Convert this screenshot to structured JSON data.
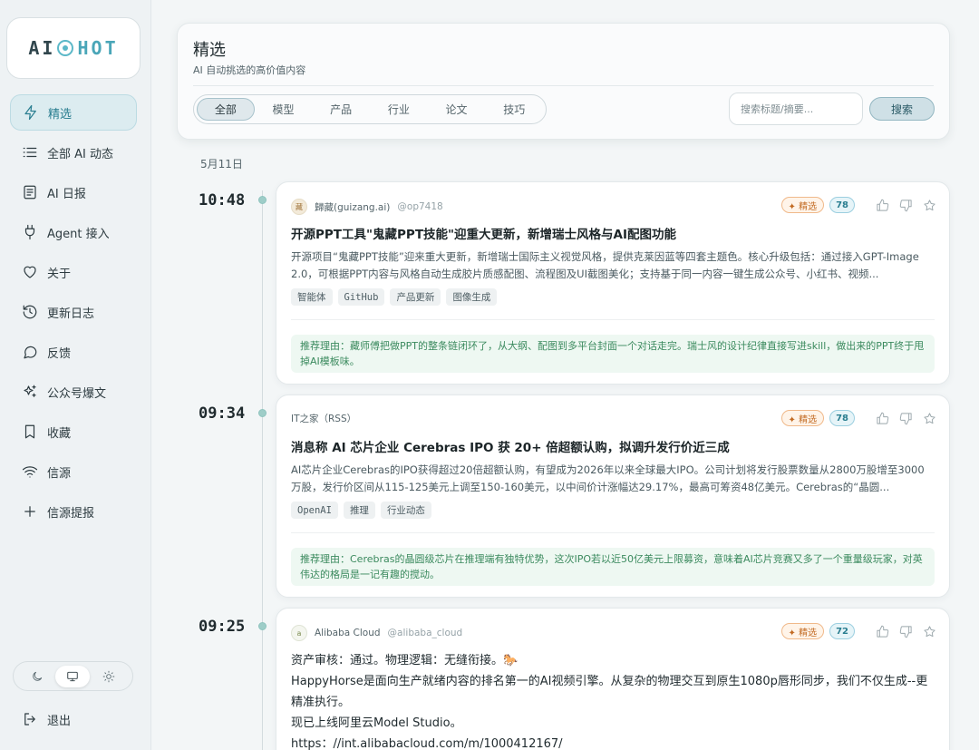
{
  "brand": {
    "logo_left": "AI",
    "logo_right": "HOT"
  },
  "sidebar": {
    "items": [
      {
        "label": "精选",
        "icon": "lightning-icon",
        "active": true
      },
      {
        "label": "全部 AI 动态",
        "icon": "list-icon"
      },
      {
        "label": "AI 日报",
        "icon": "newspaper-icon"
      },
      {
        "label": "Agent 接入",
        "icon": "plug-icon"
      },
      {
        "label": "关于",
        "icon": "heart-icon"
      },
      {
        "label": "更新日志",
        "icon": "history-icon"
      },
      {
        "label": "反馈",
        "icon": "chat-icon"
      },
      {
        "label": "公众号爆文",
        "icon": "sparkles-icon"
      },
      {
        "label": "收藏",
        "icon": "bookmark-icon"
      },
      {
        "label": "信源",
        "icon": "wifi-icon"
      },
      {
        "label": "信源提报",
        "icon": "plus-icon"
      }
    ],
    "logout": "退出"
  },
  "header": {
    "title": "精选",
    "subtitle": "AI 自动挑选的高价值内容",
    "tabs": [
      "全部",
      "模型",
      "产品",
      "行业",
      "论文",
      "技巧"
    ],
    "active_tab": "全部",
    "search_placeholder": "搜索标题/摘要...",
    "search_button": "搜索"
  },
  "feed": {
    "date": "5月11日",
    "pick_label": "✦ 精选",
    "reason_prefix": "推荐理由：",
    "items": [
      {
        "time": "10:48",
        "source": "歸藏(guizang.ai)",
        "handle": "@op7418",
        "score": "78",
        "title": "开源PPT工具\"鬼藏PPT技能\"迎重大更新，新增瑞士风格与AI配图功能",
        "summary": "开源项目“鬼藏PPT技能”迎来重大更新，新增瑞士国际主义视觉风格，提供克莱因蓝等四套主题色。核心升级包括：通过接入GPT-Image 2.0，可根据PPT内容与风格自动生成胶片质感配图、流程图及UI截图美化；支持基于同一内容一键生成公众号、小红书、视频...",
        "tags": [
          "智能体",
          "GitHub",
          "产品更新",
          "图像生成"
        ],
        "reason": "推荐理由：藏师傅把做PPT的整条链闭环了，从大纲、配图到多平台封面一个对话走完。瑞士风的设计纪律直接写进skill，做出来的PPT终于甩掉AI模板味。"
      },
      {
        "time": "09:34",
        "source": "IT之家（RSS）",
        "handle": "",
        "score": "78",
        "title": "消息称 AI 芯片企业 Cerebras IPO 获 20+ 倍超额认购，拟调升发行价近三成",
        "summary": "AI芯片企业Cerebras的IPO获得超过20倍超额认购，有望成为2026年以来全球最大IPO。公司计划将发行股票数量从2800万股增至3000万股，发行价区间从115-125美元上调至150-160美元，以中间价计涨幅达29.17%，最高可筹资48亿美元。Cerebras的“晶圆...",
        "tags": [
          "OpenAI",
          "推理",
          "行业动态"
        ],
        "reason": "推荐理由：Cerebras的晶圆级芯片在推理端有独特优势，这次IPO若以近50亿美元上限募资，意味着AI芯片竞赛又多了一个重量级玩家，对英伟达的格局是一记有趣的搅动。"
      },
      {
        "time": "09:25",
        "source": "Alibaba Cloud",
        "handle": "@alibaba_cloud",
        "score": "72",
        "lines": [
          "资产审核：通过。物理逻辑：无缝衔接。🐎",
          "HappyHorse是面向生产就绪内容的排名第一的AI视频引擎。从复杂的物理交互到原生1080p唇形同步，我们不仅生成--更精准执行。",
          "现已上线阿里云Model Studio。",
          "https：//int.alibabacloud.com/m/1000412167/"
        ]
      }
    ]
  },
  "colors": {
    "accent": "#2a7e90",
    "pick": "#c26a22",
    "reason": "#3b8a5e"
  }
}
